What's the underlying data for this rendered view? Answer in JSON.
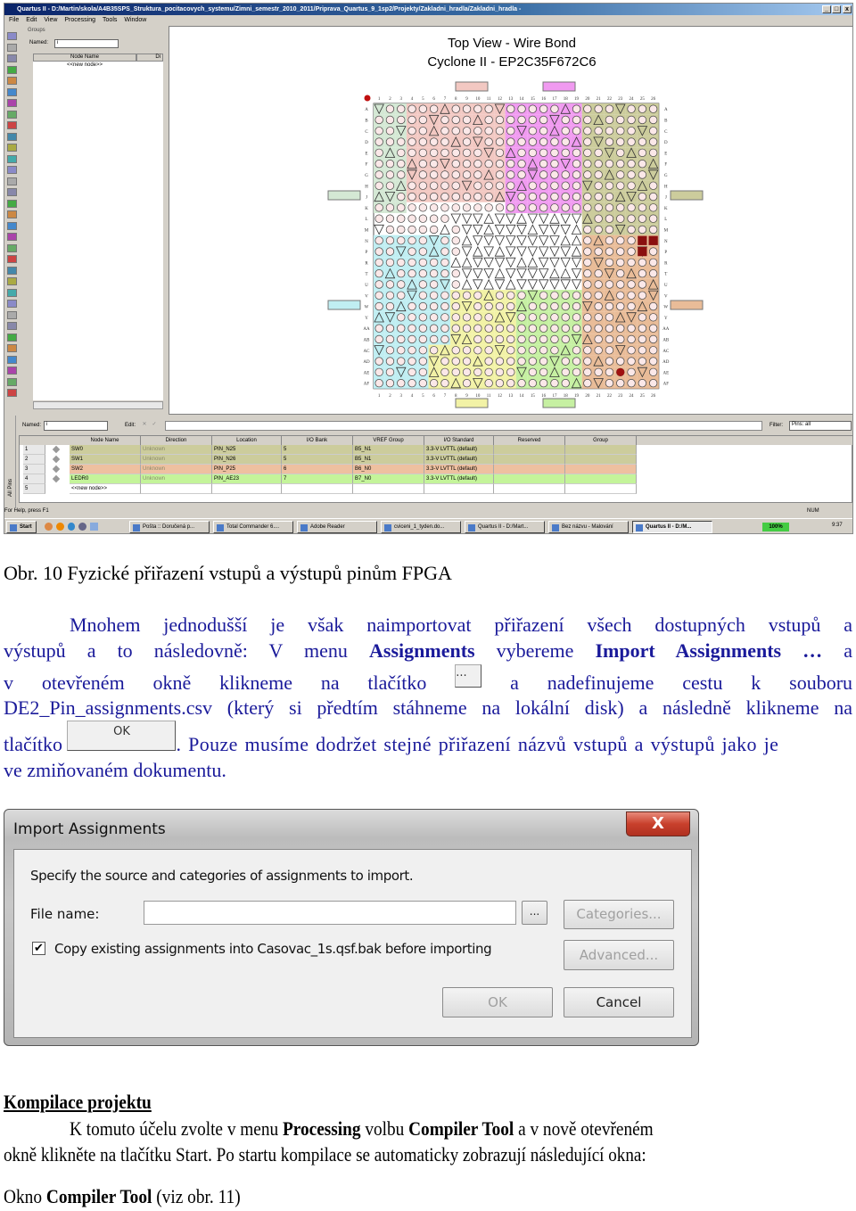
{
  "quartus": {
    "title": "Quartus II - D:/Martin/skola/A4B35SPS_Struktura_pocitacovych_systemu/Zimni_semestr_2010_2011/Priprava_Quartus_9_1sp2/Projekty/Zakladni_hradla/Zakladni_hradla -",
    "window_buttons": [
      "_",
      "□",
      "x"
    ],
    "menu": [
      "File",
      "Edit",
      "View",
      "Processing",
      "Tools",
      "Window"
    ],
    "groups": {
      "title": "Groups",
      "named_label": "Named:",
      "named_value": "i",
      "col_node_name": "Node Name",
      "col_dir": "Di",
      "new_node": "<<new node>>"
    },
    "chip": {
      "title": "Top View - Wire Bond",
      "subtitle": "Cyclone II - EP2C35F672C6",
      "columns": [
        "1",
        "2",
        "3",
        "4",
        "5",
        "6",
        "7",
        "8",
        "9",
        "10",
        "11",
        "12",
        "13",
        "14",
        "15",
        "16",
        "17",
        "18",
        "19",
        "20",
        "21",
        "22",
        "23",
        "24",
        "25",
        "26"
      ],
      "rows": [
        "A",
        "B",
        "C",
        "D",
        "E",
        "F",
        "G",
        "H",
        "J",
        "K",
        "L",
        "M",
        "N",
        "P",
        "R",
        "T",
        "U",
        "V",
        "W",
        "Y",
        "AA",
        "AB",
        "AC",
        "AD",
        "AE",
        "AF"
      ],
      "bank_colors": {
        "b1": "#d4e8d4",
        "b2": "#f2c8c2",
        "b3": "#f09af0",
        "b4": "#cccc9c",
        "b5": "#e9bc98",
        "b6": "#c6f0a2",
        "b7": "#f2f2a6",
        "b8": "#c0eef2"
      }
    },
    "pin_table": {
      "named_label": "Named:",
      "named_value": "i",
      "edit_label": "Edit:",
      "filter_label": "Filter:",
      "filter_value": "Pins: all",
      "side_tab": "All Pins",
      "headers": [
        "Node Name",
        "Direction",
        "Location",
        "I/O Bank",
        "VREF Group",
        "I/O Standard",
        "Reserved",
        "Group"
      ],
      "rows": [
        {
          "num": "1",
          "cells": [
            "SW0",
            "Unknown",
            "PIN_N25",
            "5",
            "B5_N1",
            "3.3-V LVTTL (default)",
            "",
            ""
          ],
          "color": "#cccc9c"
        },
        {
          "num": "2",
          "cells": [
            "SW1",
            "Unknown",
            "PIN_N26",
            "5",
            "B5_N1",
            "3.3-V LVTTL (default)",
            "",
            ""
          ],
          "color": "#cccc9c"
        },
        {
          "num": "3",
          "cells": [
            "SW2",
            "Unknown",
            "PIN_P25",
            "6",
            "B6_N0",
            "3.3-V LVTTL (default)",
            "",
            ""
          ],
          "color": "#eec0a0"
        },
        {
          "num": "4",
          "cells": [
            "LEDR0",
            "Unknown",
            "PIN_AE23",
            "7",
            "B7_N0",
            "3.3-V LVTTL (default)",
            "",
            ""
          ],
          "color": "#c4f49a"
        },
        {
          "num": "5",
          "cells": [
            "<<new node>>",
            "",
            "",
            "",
            "",
            "",
            "",
            ""
          ],
          "color": "#ffffff"
        }
      ]
    },
    "status": {
      "help": "For Help, press F1",
      "num": "NUM"
    },
    "taskbar": {
      "start": "Start",
      "tasks": [
        "Pošta :: Doručená p...",
        "Total Commander 6....",
        "Adobe Reader",
        "cviceni_1_tyden.do...",
        "Quartus II - D:/Mart...",
        "Bez názvu - Malování",
        "Quartus II - D:/M..."
      ],
      "battery": "100%",
      "clock": "9:37"
    }
  },
  "caption": "Obr. 10 Fyzické přiřazení vstupů a výstupů pinům FPGA",
  "paragraph1": {
    "l1": "Mnohem jednodušší je však naimportovat přiřazení všech dostupných vstupů a",
    "l2a": "výstupů a to následovně: V menu ",
    "l2b": "Assignments",
    "l2c": " vybereme ",
    "l2d": "Import Assignments …",
    "l2e": " a",
    "l3a": "v otevřeném okně klikneme na tlačítko",
    "l3_btn": "...",
    "l3b": "a nadefinujeme cestu k souboru",
    "l4": "DE2_Pin_assignments.csv (který si předtím stáhneme na lokální disk) a následně klikneme na",
    "l5a": "tlačítko",
    "l5_btn": "OK",
    "l5b": ". Pouze musíme dodržet stejné přiřazení názvů vstupů a výstupů jako je",
    "l6": "ve zmiňovaném dokumentu.",
    "color": "#1a1a9a"
  },
  "dialog": {
    "title": "Import Assignments",
    "close": "X",
    "instruction": "Specify the source and categories of assignments to import.",
    "file_label": "File name:",
    "file_value": "",
    "browse": "...",
    "categories": "Categories...",
    "checkbox_checked": true,
    "checkbox_label": "Copy existing assignments into Casovac_1s.qsf.bak before importing",
    "advanced": "Advanced...",
    "ok": "OK",
    "cancel": "Cancel"
  },
  "section": {
    "heading": "Kompilace projektu",
    "p1a": "K tomuto účelu zvolte v menu ",
    "p1b": "Processing",
    "p1c": " volbu ",
    "p1d": "Compiler Tool",
    "p1e": " a v nově otevřeném",
    "p2": "okně klikněte na tlačítku Start. Po startu kompilace se automaticky zobrazují následující okna:",
    "p3a": "Okno ",
    "p3b": "Compiler Tool",
    "p3c": " (viz obr. 11)"
  }
}
